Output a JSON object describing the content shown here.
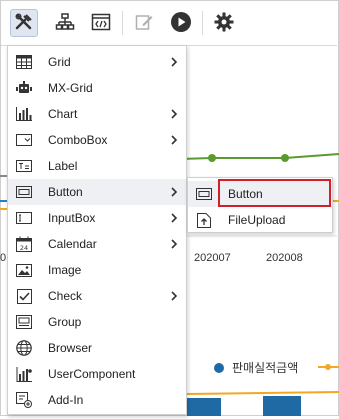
{
  "toolbar": {
    "buttons": [
      {
        "icon": "tools-icon",
        "active": true
      },
      {
        "icon": "sitemap-icon",
        "active": false
      },
      {
        "icon": "code-window-icon",
        "active": false
      },
      {
        "icon": "edit-icon",
        "active": false
      },
      {
        "icon": "play-icon",
        "active": false
      },
      {
        "icon": "gear-icon",
        "active": false
      }
    ]
  },
  "background_chart": {
    "x_labels": [
      "0",
      "202007",
      "202008"
    ],
    "legend": {
      "series1": "판매실적금액"
    },
    "colors": {
      "line_green": "#5a9b2f",
      "line_orange": "#f5a623",
      "bar_blue": "#1f6aa5",
      "dot_blue": "#1f6aa5"
    }
  },
  "menu": {
    "items": [
      {
        "label": "Grid",
        "icon": "grid-icon",
        "submenu": true
      },
      {
        "label": "MX-Grid",
        "icon": "mx-grid-icon",
        "submenu": false
      },
      {
        "label": "Chart",
        "icon": "chart-icon",
        "submenu": true
      },
      {
        "label": "ComboBox",
        "icon": "combobox-icon",
        "submenu": true
      },
      {
        "label": "Label",
        "icon": "label-icon",
        "submenu": false
      },
      {
        "label": "Button",
        "icon": "button-icon",
        "submenu": true
      },
      {
        "label": "InputBox",
        "icon": "inputbox-icon",
        "submenu": true
      },
      {
        "label": "Calendar",
        "icon": "calendar-icon",
        "submenu": true
      },
      {
        "label": "Image",
        "icon": "image-icon",
        "submenu": false
      },
      {
        "label": "Check",
        "icon": "check-icon",
        "submenu": true
      },
      {
        "label": "Group",
        "icon": "group-icon",
        "submenu": false
      },
      {
        "label": "Browser",
        "icon": "globe-icon",
        "submenu": false
      },
      {
        "label": "UserComponent",
        "icon": "user-component-icon",
        "submenu": false
      },
      {
        "label": "Add-In",
        "icon": "add-in-icon",
        "submenu": false
      }
    ]
  },
  "submenu": {
    "items": [
      {
        "label": "Button",
        "icon": "button-icon",
        "highlighted": true
      },
      {
        "label": "FileUpload",
        "icon": "file-upload-icon",
        "highlighted": false
      }
    ]
  },
  "colors": {
    "accent_highlight": "#d0202a",
    "hover_bg": "#eef0f4"
  }
}
